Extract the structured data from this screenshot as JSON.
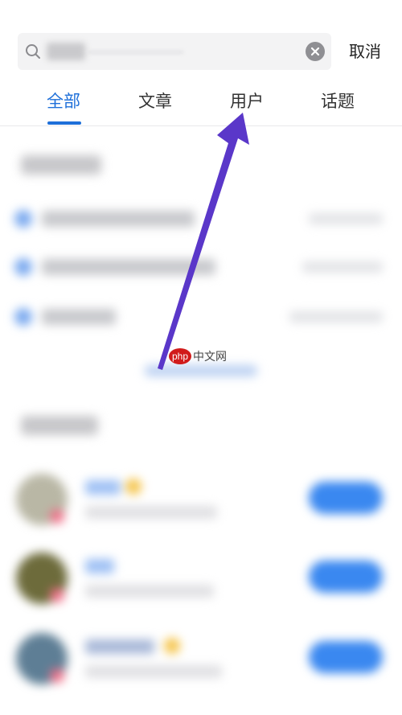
{
  "search": {
    "cancel_label": "取消"
  },
  "tabs": [
    {
      "label": "全部",
      "active": true
    },
    {
      "label": "文章",
      "active": false
    },
    {
      "label": "用户",
      "active": false
    },
    {
      "label": "话题",
      "active": false
    }
  ],
  "colors": {
    "accent": "#1e6fd9",
    "arrow": "#5a37c9",
    "follow_button": "#3a88f0"
  },
  "watermark": {
    "logo": "php",
    "text": "中文网"
  }
}
